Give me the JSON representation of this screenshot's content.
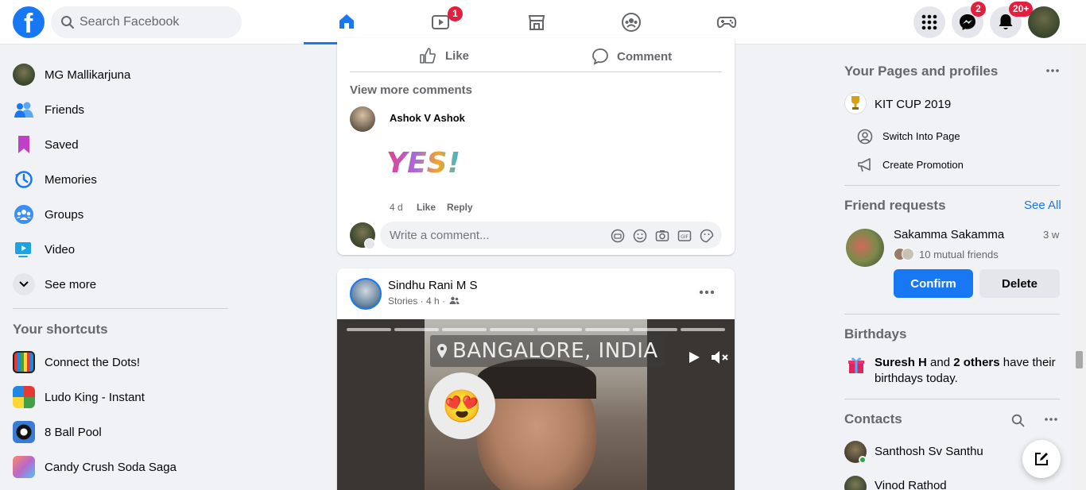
{
  "nav": {
    "search_placeholder": "Search Facebook",
    "watch_badge": "1",
    "messenger_badge": "2",
    "notifications_badge": "20+"
  },
  "left": {
    "profile_name": "MG Mallikarjuna",
    "items": [
      {
        "label": "Friends"
      },
      {
        "label": "Saved"
      },
      {
        "label": "Memories"
      },
      {
        "label": "Groups"
      },
      {
        "label": "Video"
      },
      {
        "label": "See more"
      }
    ],
    "shortcuts_title": "Your shortcuts",
    "shortcuts": [
      {
        "label": "Connect the Dots!"
      },
      {
        "label": "Ludo King - Instant"
      },
      {
        "label": "8 Ball Pool"
      },
      {
        "label": "Candy Crush Soda Saga"
      }
    ]
  },
  "post1": {
    "like": "Like",
    "comment": "Comment",
    "view_more": "View more comments",
    "commenter": "Ashok V Ashok",
    "sticker_text": "YES!",
    "time": "4 d",
    "like_link": "Like",
    "reply_link": "Reply",
    "write_placeholder": "Write a comment..."
  },
  "post2": {
    "author": "Sindhu Rani M S",
    "meta": "Stories · 4 h ·",
    "location": "BANGALORE, INDIA",
    "emoji": "😍"
  },
  "right": {
    "pages_title": "Your Pages and profiles",
    "page_name": "KIT CUP 2019",
    "switch_label": "Switch Into Page",
    "promo_label": "Create Promotion",
    "fr_title": "Friend requests",
    "see_all": "See All",
    "fr_name": "Sakamma Sakamma",
    "fr_time": "3 w",
    "fr_mutual": "10 mutual friends",
    "confirm": "Confirm",
    "delete": "Delete",
    "birthdays_title": "Birthdays",
    "bday_name": "Suresh H",
    "bday_and": " and ",
    "bday_others": "2 others",
    "bday_rest": " have their birthdays today.",
    "contacts_title": "Contacts",
    "contacts": [
      {
        "name": "Santhosh Sv Santhu"
      },
      {
        "name": "Vinod Rathod"
      }
    ]
  },
  "colors": {
    "brand": "#1877f2",
    "badge": "#e41e3f"
  }
}
